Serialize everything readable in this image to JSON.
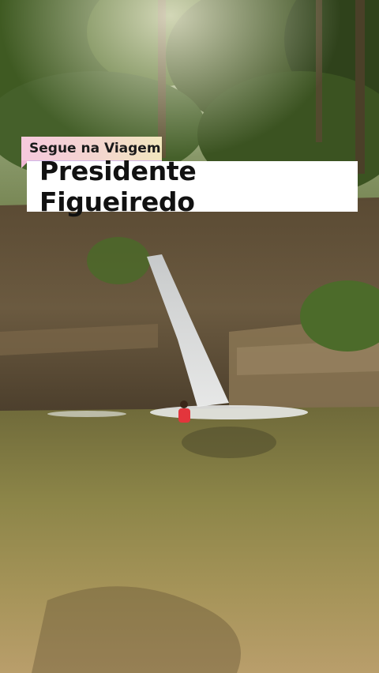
{
  "overlay": {
    "brand": "Segue na Viagem",
    "title": "Presidente Figueiredo"
  },
  "colors": {
    "brand_gradient_start": "#f6c9dd",
    "brand_gradient_end": "#f2e7bd",
    "title_background": "#ffffff",
    "text": "#111111"
  }
}
